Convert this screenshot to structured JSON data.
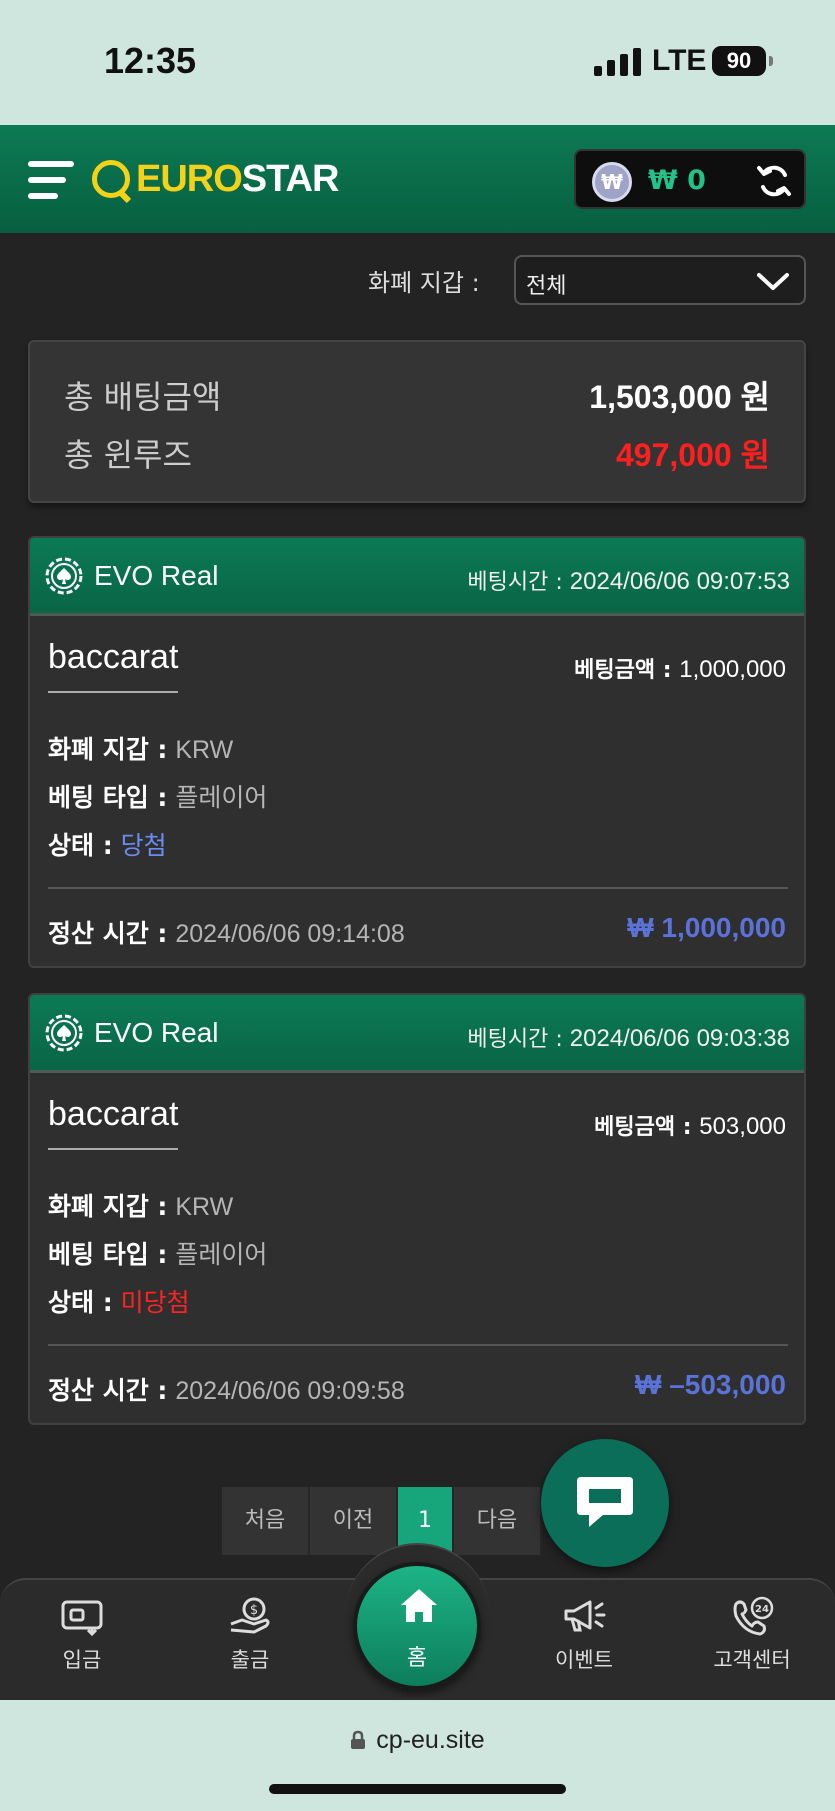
{
  "status_bar": {
    "time": "12:35",
    "network": "LTE",
    "battery": "90"
  },
  "header": {
    "logo_euro": "EURO",
    "logo_star": "STAR",
    "wallet_symbol": "₩",
    "wallet_amount": "₩ 0"
  },
  "filter": {
    "label": "화폐 지갑 :",
    "selected": "전체"
  },
  "summary": {
    "total_bet_label": "총 배팅금액",
    "total_bet_value": "1,503,000 원",
    "total_winloss_label": "총 윈루즈",
    "total_winloss_value": "497,000 원"
  },
  "bets": [
    {
      "provider": "EVO Real",
      "bet_time_label": "베팅시간 :",
      "bet_time": "2024/06/06 09:07:53",
      "game": "baccarat",
      "bet_amount_label": "베팅금액 :",
      "bet_amount": "1,000,000",
      "currency_label": "화폐 지갑 :",
      "currency": "KRW",
      "bet_type_label": "베팅 타입 :",
      "bet_type": "플레이어",
      "status_label": "상태 :",
      "status": "당첨",
      "settle_label": "정산 시간 :",
      "settle_time": "2024/06/06 09:14:08",
      "settle_amount": "₩ 1,000,000"
    },
    {
      "provider": "EVO Real",
      "bet_time_label": "베팅시간 :",
      "bet_time": "2024/06/06 09:03:38",
      "game": "baccarat",
      "bet_amount_label": "베팅금액 :",
      "bet_amount": "503,000",
      "currency_label": "화폐 지갑 :",
      "currency": "KRW",
      "bet_type_label": "베팅 타입 :",
      "bet_type": "플레이어",
      "status_label": "상태 :",
      "status": "미당첨",
      "settle_label": "정산 시간 :",
      "settle_time": "2024/06/06 09:09:58",
      "settle_amount": "₩ –503,000"
    }
  ],
  "pagination": {
    "first": "처음",
    "prev": "이전",
    "current": "1",
    "next": "다음"
  },
  "bottom_nav": {
    "deposit": "입금",
    "withdraw": "출금",
    "home": "홈",
    "event": "이벤트",
    "support": "고객센터"
  },
  "browser": {
    "url": "cp-eu.site"
  },
  "colors": {
    "brand_green": "#0c7a54",
    "accent_yellow": "#f5d21a",
    "win_blue": "#6b8cf2",
    "loss_red": "#ff2222",
    "settle_blue": "#5b73d8"
  }
}
